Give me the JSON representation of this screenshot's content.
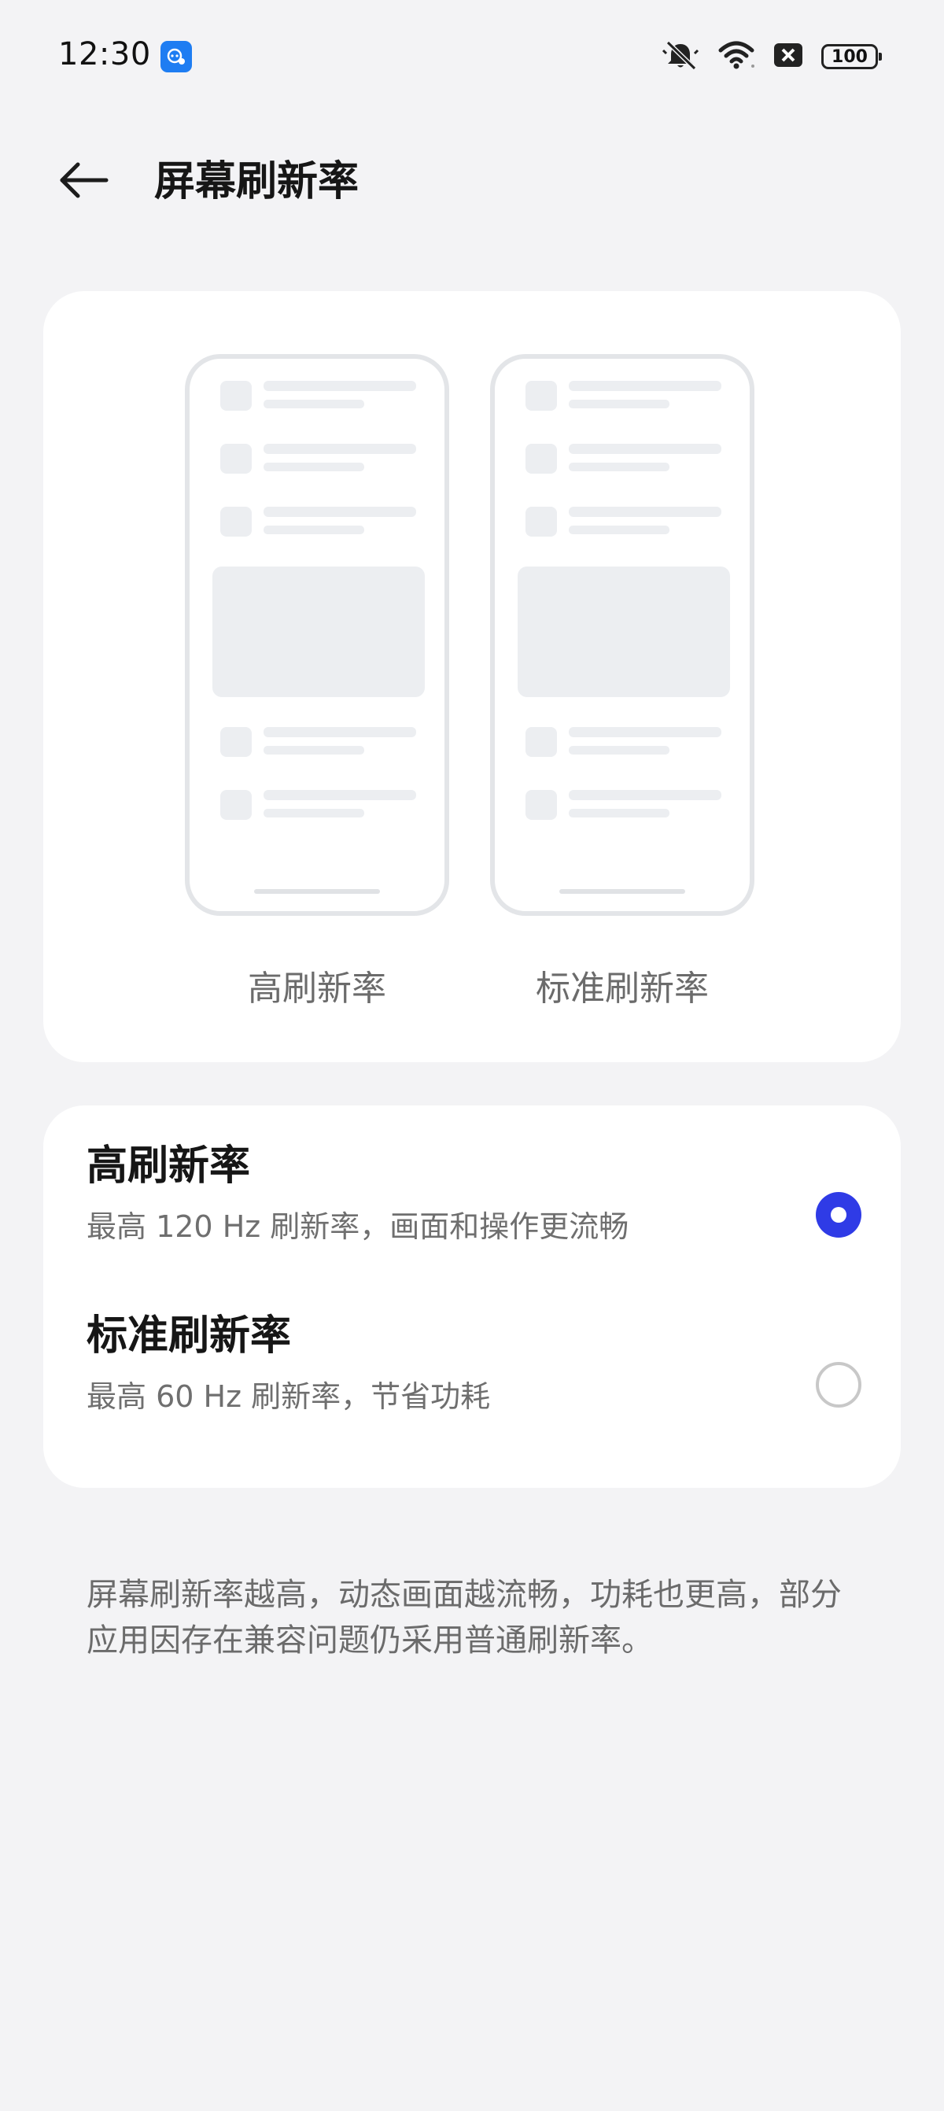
{
  "status_bar": {
    "time": "12:30",
    "notification_icon": "app-assistant-icon",
    "icons": [
      "silent-bell-icon",
      "wifi-icon",
      "sim-off-icon"
    ],
    "battery": "100"
  },
  "header": {
    "back_icon": "back-arrow-icon",
    "title": "屏幕刷新率"
  },
  "preview": {
    "left_label": "高刷新率",
    "right_label": "标准刷新率"
  },
  "options": [
    {
      "title": "高刷新率",
      "description": "最高 120 Hz 刷新率，画面和操作更流畅",
      "selected": true
    },
    {
      "title": "标准刷新率",
      "description": "最高 60 Hz 刷新率，节省功耗",
      "selected": false
    }
  ],
  "footnote": "屏幕刷新率越高，动态画面越流畅，功耗也更高，部分应用因存在兼容问题仍采用普通刷新率。",
  "colors": {
    "accent": "#2f3be6",
    "background": "#f3f3f5",
    "card": "#ffffff"
  }
}
